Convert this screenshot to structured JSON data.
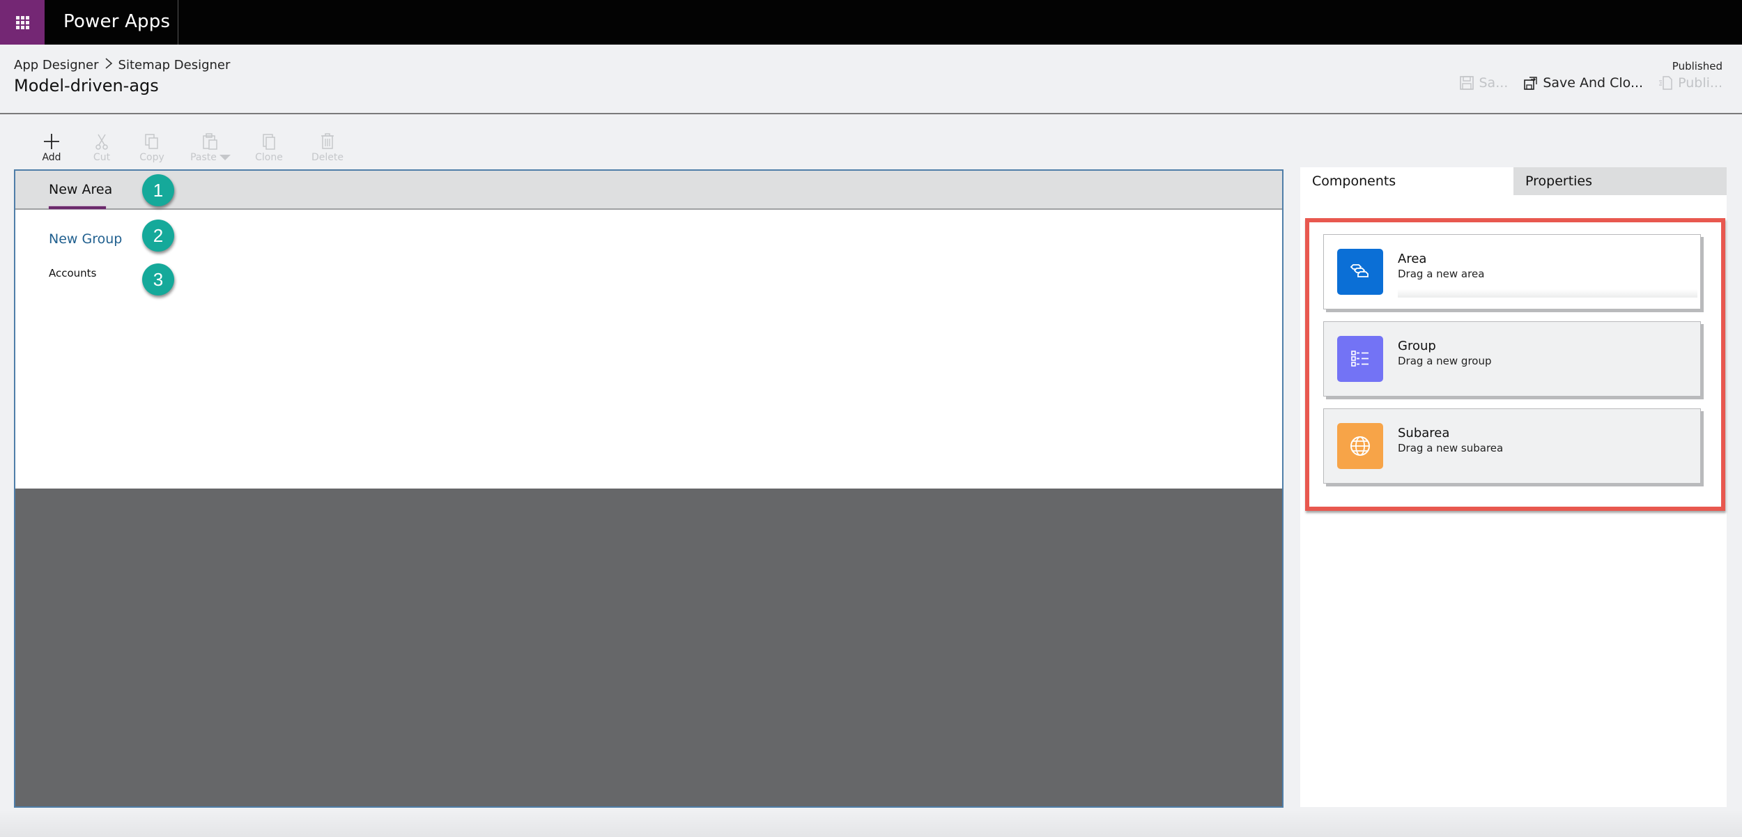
{
  "topbar": {
    "app_title": "Power Apps",
    "waffle_icon": "waffle-grid-icon",
    "brand_color": "#742774"
  },
  "header": {
    "breadcrumb": [
      "App Designer",
      "Sitemap Designer"
    ],
    "breadcrumb_separator": ">",
    "title": "Model-driven-ags",
    "status": "Published",
    "commands": [
      {
        "label": "Sa...",
        "icon": "save-icon",
        "enabled": false
      },
      {
        "label": "Save And Clo...",
        "icon": "save-and-close-icon",
        "enabled": true
      },
      {
        "label": "Publi...",
        "icon": "publish-icon",
        "enabled": false
      }
    ]
  },
  "toolbar": {
    "items": [
      {
        "label": "Add",
        "icon": "plus-icon",
        "enabled": true
      },
      {
        "label": "Cut",
        "icon": "scissors-icon",
        "enabled": false
      },
      {
        "label": "Copy",
        "icon": "copy-icon",
        "enabled": false
      },
      {
        "label": "Paste",
        "icon": "paste-icon",
        "enabled": false,
        "dropdown": true
      },
      {
        "label": "Clone",
        "icon": "clone-icon",
        "enabled": false
      },
      {
        "label": "Delete",
        "icon": "trash-icon",
        "enabled": false
      }
    ]
  },
  "canvas": {
    "area_tab": "New Area",
    "group": "New Group",
    "subarea": "Accounts",
    "badges": [
      "1",
      "2",
      "3"
    ],
    "badge_color": "#15a99a",
    "accent_underline": "#6b2a6b",
    "group_color": "#21608f"
  },
  "right_panel": {
    "tabs": [
      {
        "label": "Components",
        "active": true
      },
      {
        "label": "Properties",
        "active": false
      }
    ],
    "highlight_color": "#e8584f",
    "components": [
      {
        "title": "Area",
        "description": "Drag a new area",
        "icon": "area-stack-icon",
        "color": "#0b6fd6"
      },
      {
        "title": "Group",
        "description": "Drag a new group",
        "icon": "list-icon",
        "color": "#7373f5"
      },
      {
        "title": "Subarea",
        "description": "Drag a new subarea",
        "icon": "globe-icon",
        "color": "#f7a448"
      }
    ]
  }
}
